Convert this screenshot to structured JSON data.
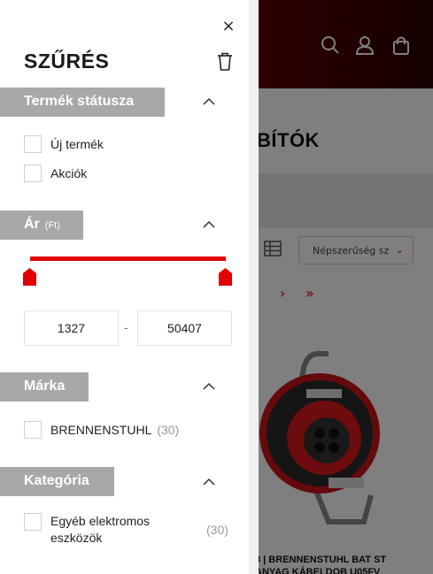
{
  "background": {
    "category_title": "BÍTÓK",
    "sort_value": "Népszerűség sz",
    "pager": [
      "›",
      "»"
    ],
    "product_title_line1": "8 | BRENNENSTUHL BAT ST",
    "product_title_line2": "ANYAG KÁBELDOB U05FV",
    "colors": {
      "header_dark": "#5a0000",
      "accent": "#d40000"
    },
    "icons": [
      "search-icon",
      "user-icon",
      "bag-icon",
      "grid-view-icon",
      "chevron-down-icon"
    ]
  },
  "filter": {
    "title": "SZŰRÉS",
    "close": "×",
    "sections": {
      "status": {
        "heading": "Termék státusza",
        "options": [
          {
            "label": "Új termék",
            "checked": false
          },
          {
            "label": "Akciók",
            "checked": false
          }
        ]
      },
      "price": {
        "heading": "Ár",
        "unit": "(Ft)",
        "min": "1327",
        "max": "50407",
        "separator": "-"
      },
      "brand": {
        "heading": "Márka",
        "options": [
          {
            "label": "BRENNENSTUHL",
            "count": "(30)",
            "checked": false
          }
        ]
      },
      "category": {
        "heading": "Kategória",
        "options": [
          {
            "label": "Egyéb elektromos eszközök",
            "count": "(30)",
            "checked": false
          }
        ]
      }
    },
    "colors": {
      "section_bg": "#a8a8a8",
      "slider": "#e10000"
    }
  }
}
